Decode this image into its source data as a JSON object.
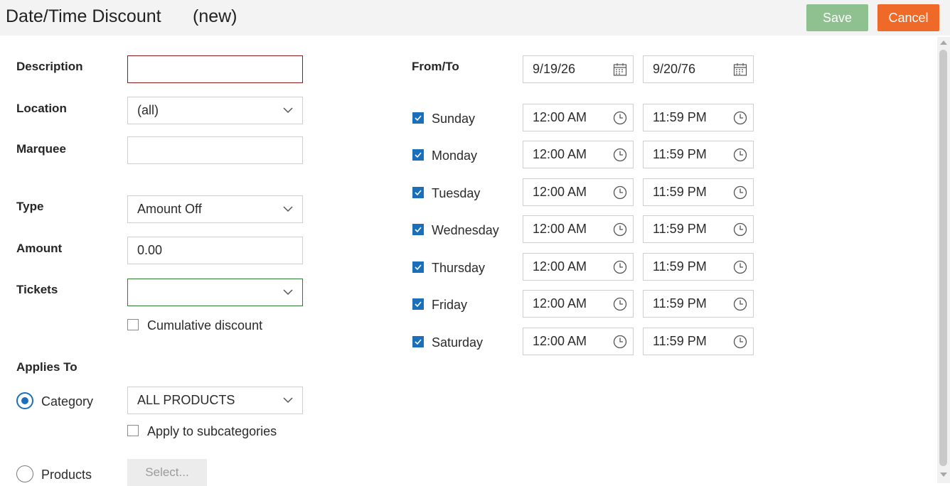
{
  "header": {
    "title": "Date/Time Discount",
    "subtitle": "(new)",
    "save_label": "Save",
    "cancel_label": "Cancel"
  },
  "form": {
    "description_label": "Description",
    "description_value": "",
    "location_label": "Location",
    "location_value": "(all)",
    "marquee_label": "Marquee",
    "marquee_value": "",
    "type_label": "Type",
    "type_value": "Amount Off",
    "amount_label": "Amount",
    "amount_value": "0.00",
    "tickets_label": "Tickets",
    "tickets_value": "",
    "cumulative_label": "Cumulative discount",
    "cumulative_checked": false,
    "applies_to_label": "Applies To",
    "category_label": "Category",
    "category_selected": true,
    "category_value": "ALL PRODUCTS",
    "subcategories_label": "Apply to subcategories",
    "subcategories_checked": false,
    "products_label": "Products",
    "products_selected": false,
    "select_label": "Select..."
  },
  "schedule": {
    "from_to_label": "From/To",
    "from_date": "9/19/26",
    "to_date": "9/20/76",
    "days": [
      {
        "name": "Sunday",
        "checked": true,
        "start": "12:00 AM",
        "end": "11:59 PM"
      },
      {
        "name": "Monday",
        "checked": true,
        "start": "12:00 AM",
        "end": "11:59 PM"
      },
      {
        "name": "Tuesday",
        "checked": true,
        "start": "12:00 AM",
        "end": "11:59 PM"
      },
      {
        "name": "Wednesday",
        "checked": true,
        "start": "12:00 AM",
        "end": "11:59 PM"
      },
      {
        "name": "Thursday",
        "checked": true,
        "start": "12:00 AM",
        "end": "11:59 PM"
      },
      {
        "name": "Friday",
        "checked": true,
        "start": "12:00 AM",
        "end": "11:59 PM"
      },
      {
        "name": "Saturday",
        "checked": true,
        "start": "12:00 AM",
        "end": "11:59 PM"
      }
    ]
  },
  "colors": {
    "save": "#8fc08f",
    "cancel": "#ef6a28",
    "accent": "#1a6fba",
    "error_border": "#8b1a1a",
    "valid_border": "#2e7d32"
  },
  "icons": {
    "dropdown": "chevron-down-icon",
    "date": "calendar-icon",
    "time": "clock-icon",
    "check": "check-icon"
  }
}
